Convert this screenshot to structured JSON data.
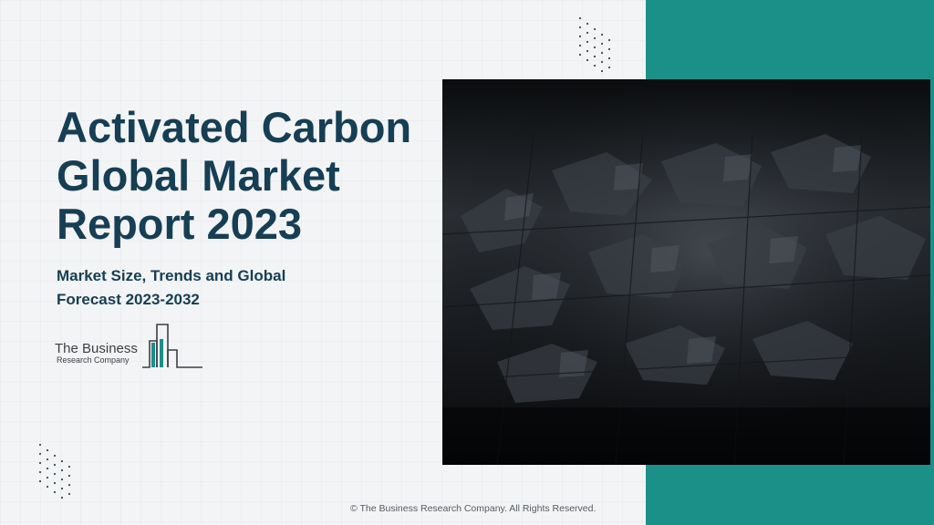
{
  "slide": {
    "title": "Activated Carbon Global Market Report 2023",
    "subtitle": "Market Size, Trends and Global Forecast 2023-2032",
    "logo": {
      "line1": "The Business",
      "line2": "Research Company",
      "icon": "bar-chart-logo-icon",
      "accent_color": "#1a9088"
    },
    "footer": "© The Business Research Company. All Rights Reserved.",
    "image": "activated-carbon-photo"
  },
  "colors": {
    "title": "#163e54",
    "teal": "#1a9088",
    "background": "#f3f4f5"
  }
}
